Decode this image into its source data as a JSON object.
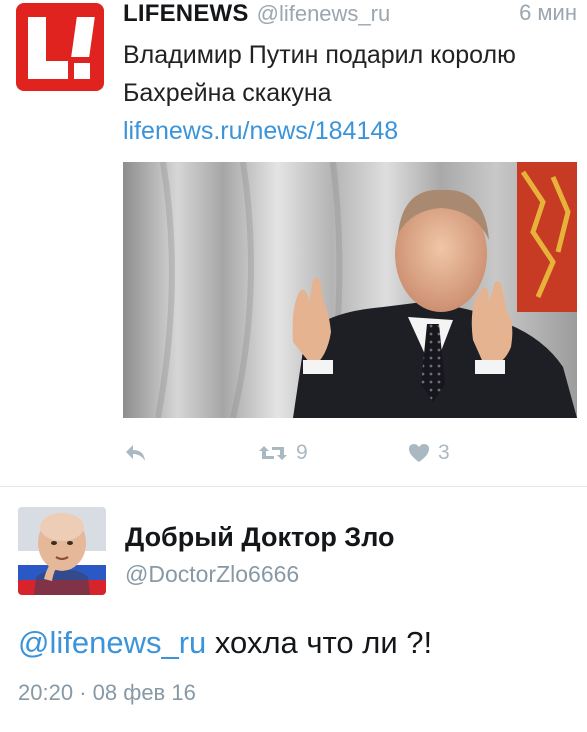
{
  "tweet1": {
    "author_name": "LIFENEWS",
    "author_handle": "@lifenews_ru",
    "time": "6 мин",
    "text": "Владимир Путин подарил королю Бахрейна скакуна",
    "link": "lifenews.ru/news/184148",
    "retweet_count": "9",
    "like_count": "3"
  },
  "tweet2": {
    "author_name": "Добрый Доктор Зло",
    "author_handle": "@DoctorZlo6666",
    "mention": "@lifenews_ru",
    "text": " хохла что ли ?!",
    "time": "20:20",
    "separator": "·",
    "date": "08 фев 16"
  },
  "colors": {
    "link": "#3b94d9",
    "muted": "#8899a6",
    "brand_red": "#e0231f"
  },
  "icons": {
    "reply": "reply-icon",
    "retweet": "retweet-icon",
    "like": "heart-icon"
  }
}
